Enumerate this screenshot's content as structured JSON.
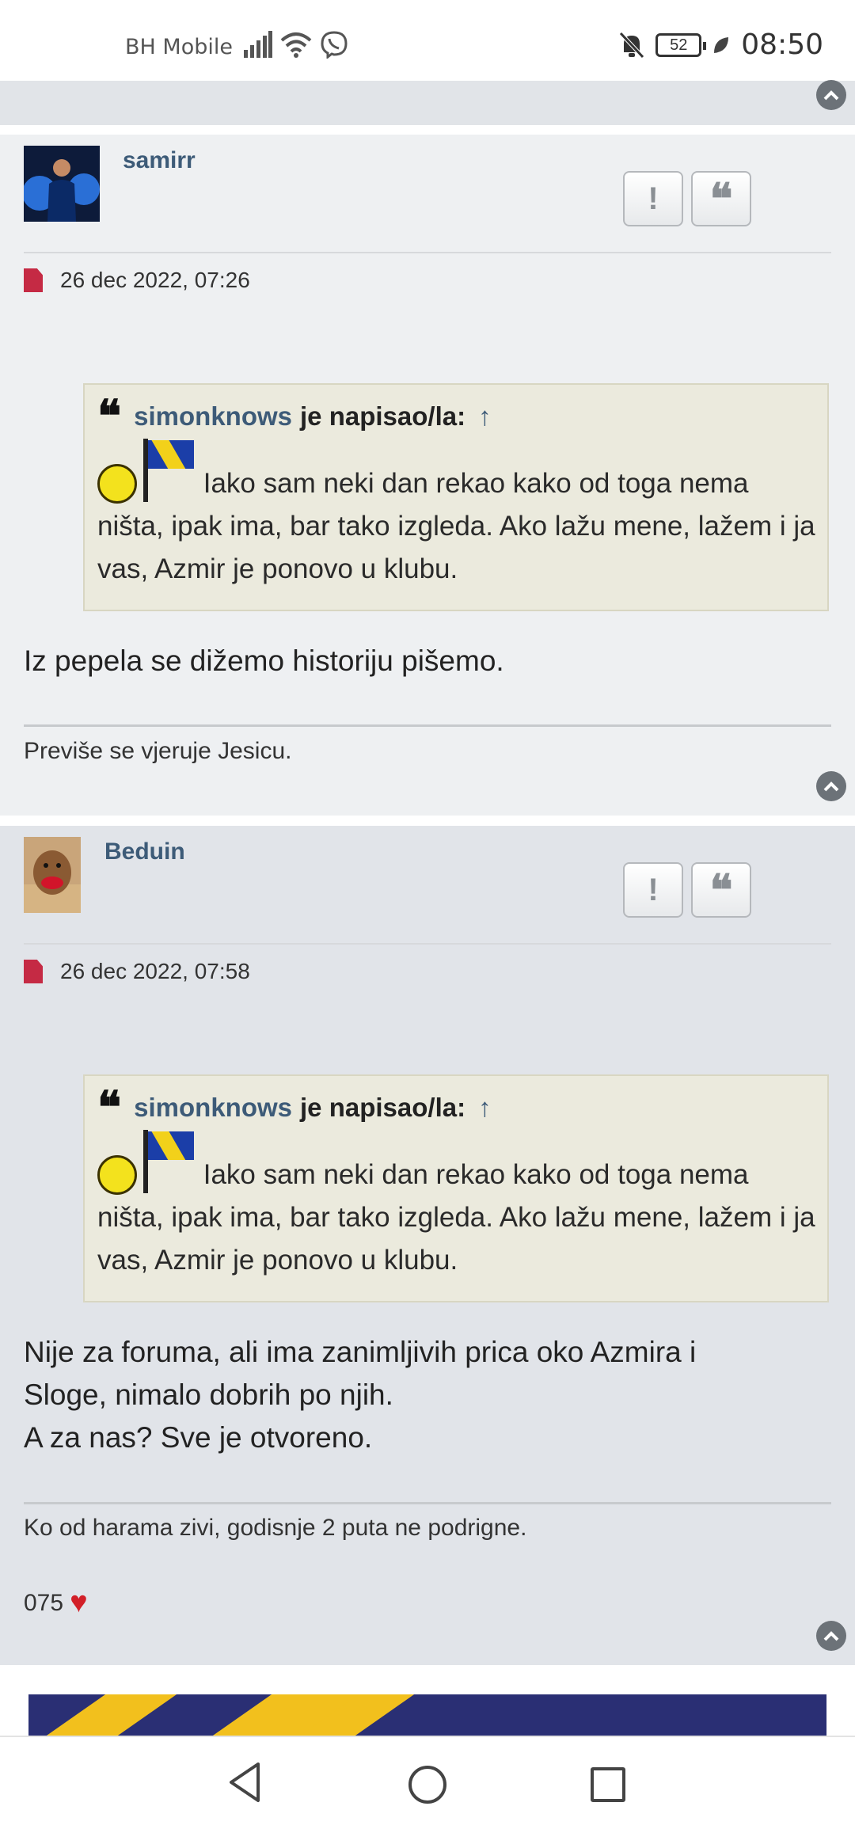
{
  "status_bar": {
    "carrier": "BH Mobile",
    "battery": "52",
    "time": "08:50",
    "icons": [
      "signal-icon",
      "wifi-icon",
      "viber-icon",
      "bell-off-icon",
      "battery-icon",
      "leaf-icon"
    ]
  },
  "posts": [
    {
      "username": "samirr",
      "date": "26 dec 2022, 07:26",
      "quote": {
        "author": "simonknows",
        "wrote": "je napisao/la:",
        "arrow": "↑",
        "text": "Iako sam neki dan rekao kako od toga nema ništa, ipak ima, bar tako izgleda. Ako lažu mene, lažem i ja vas, Azmir je ponovo u klubu."
      },
      "body": [
        "Iz pepela se dižemo historiju pišemo."
      ],
      "signature": [
        "Previše se vjeruje Jesicu."
      ]
    },
    {
      "username": "Beduin",
      "date": "26 dec 2022, 07:58",
      "quote": {
        "author": "simonknows",
        "wrote": "je napisao/la:",
        "arrow": "↑",
        "text": "Iako sam neki dan rekao kako od toga nema ništa, ipak ima, bar tako izgleda. Ako lažu mene, lažem i ja vas, Azmir je ponovo u klubu."
      },
      "body": [
        "Nije za foruma, ali ima zanimljivih prica oko Azmira i",
        "Sloge, nimalo dobrih po njih.",
        "A za nas? Sve je otvoreno."
      ],
      "signature": [
        "Ko od harama zivi, godisnje 2 puta ne podrigne.",
        "075"
      ]
    }
  ],
  "buttons": {
    "report": "!",
    "quote": "❝"
  },
  "colors": {
    "link": "#3d5b78",
    "quote_bg": "#ebeadd",
    "post_bg_1": "#eef0f2",
    "post_bg_2": "#e1e4e9",
    "file_icon": "#c52a44"
  }
}
